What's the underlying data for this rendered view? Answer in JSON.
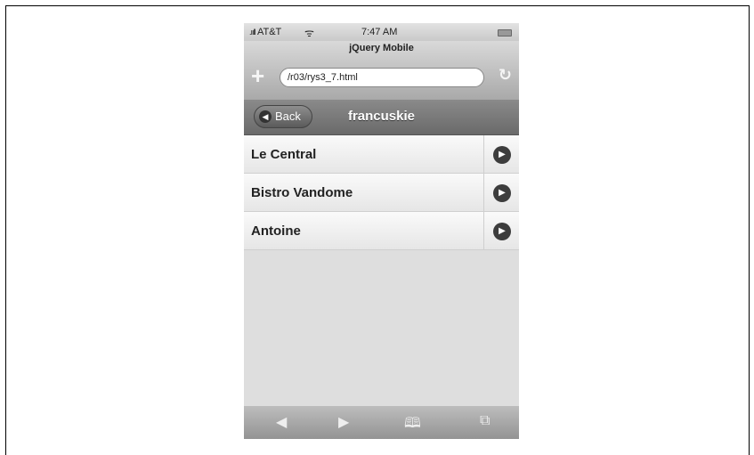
{
  "status_bar": {
    "carrier": "AT&T",
    "time": "7:47 AM",
    "signal_icon": "signal-bars-icon",
    "wifi_icon": "wifi-icon",
    "battery_icon": "battery-icon"
  },
  "browser": {
    "title": "jQuery Mobile",
    "url": "/r03/rys3_7.html"
  },
  "header": {
    "back_label": "Back",
    "title": "francuskie"
  },
  "list": {
    "items": [
      {
        "label": "Le Central"
      },
      {
        "label": "Bistro Vandome"
      },
      {
        "label": "Antoine"
      }
    ]
  }
}
